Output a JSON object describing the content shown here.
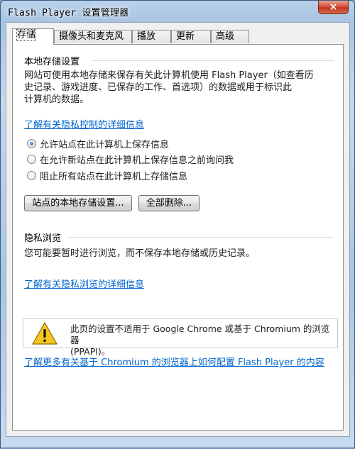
{
  "window": {
    "title": "Flash Player 设置管理器",
    "close_label": "×"
  },
  "tabs": [
    {
      "label": "存储",
      "active": true
    },
    {
      "label": "摄像头和麦克风",
      "active": false
    },
    {
      "label": "播放",
      "active": false
    },
    {
      "label": "更新",
      "active": false
    },
    {
      "label": "高级",
      "active": false
    }
  ],
  "local_storage": {
    "title": "本地存储设置",
    "description_line1": "网站可使用本地存储来保存有关此计算机使用 Flash Player（如查看历",
    "description_line2": "史记录、游戏进度、已保存的工作、首选项）的数据或用于标识此",
    "description_line3": "计算机的数据。",
    "privacy_link": "了解有关隐私控制的详细信息",
    "options": [
      {
        "label": "允许站点在此计算机上保存信息",
        "checked": true
      },
      {
        "label": "在允许新站点在此计算机上保存信息之前询问我",
        "checked": false
      },
      {
        "label": "阻止所有站点在此计算机上存储信息",
        "checked": false
      }
    ],
    "site_settings_button": "站点的本地存储设置...",
    "delete_all_button": "全部删除..."
  },
  "private_browsing": {
    "title": "隐私浏览",
    "description": "您可能要暂时进行浏览，而不保存本地存储或历史记录。",
    "link": "了解有关隐私浏览的详细信息"
  },
  "notice": {
    "icon": "warning-icon",
    "text_line1": "此页的设置不适用于 Google Chrome 或基于 Chromium 的浏览器",
    "text_line2": "(PPAPI)。"
  },
  "chromium_link": "了解更多有关基于 Chromium 的浏览器上如何配置 Flash Player 的内容",
  "colors": {
    "link": "#0066cc",
    "title_close": "#c2381f",
    "frame": "#a9c4e2"
  }
}
